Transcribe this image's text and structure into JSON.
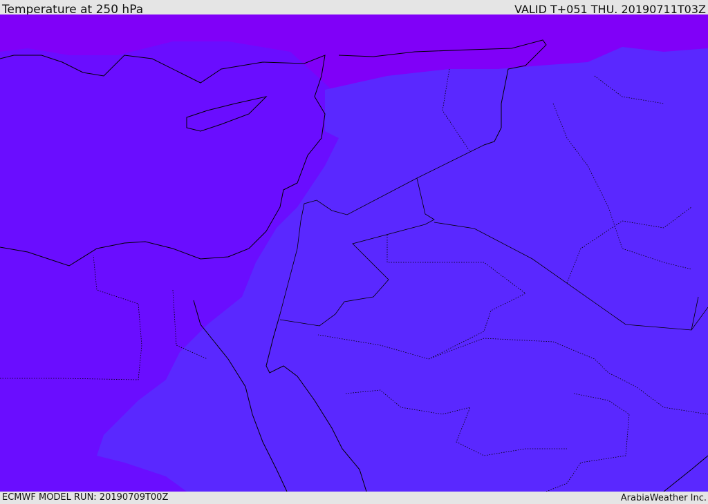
{
  "header": {
    "title": "Temperature at 250 hPa",
    "valid_time": "VALID T+051 THU. 20190711T03Z"
  },
  "footer": {
    "model_run": "ECMWF MODEL RUN: 20190709T00Z",
    "brand": "ArabiaWeather Inc."
  },
  "map": {
    "colors": {
      "cold_band": "#8000f8",
      "mid_band": "#6a0dff",
      "warm_band": "#5a28ff",
      "coastline": "#000000"
    }
  }
}
